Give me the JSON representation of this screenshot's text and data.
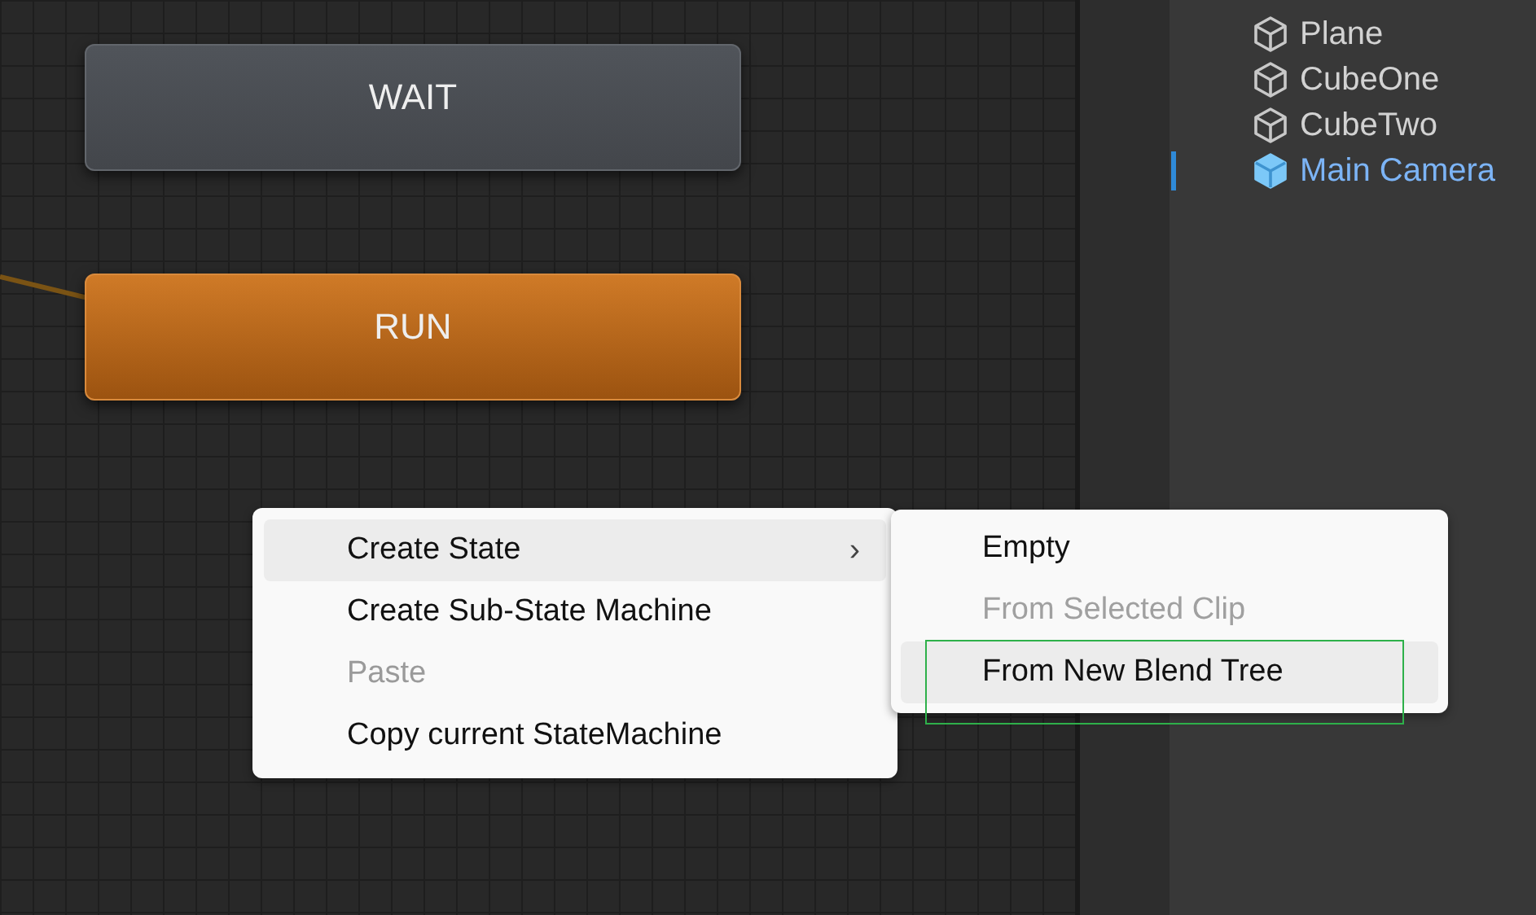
{
  "nodes": [
    {
      "label": "WAIT",
      "kind": "default"
    },
    {
      "label": "RUN",
      "kind": "entry"
    }
  ],
  "hierarchy": [
    {
      "label": "Plane",
      "selected": false
    },
    {
      "label": "CubeOne",
      "selected": false
    },
    {
      "label": "CubeTwo",
      "selected": false
    },
    {
      "label": "Main Camera",
      "selected": true
    }
  ],
  "context_menu": [
    {
      "label": "Create State",
      "disabled": false,
      "selected": true,
      "submenu": true
    },
    {
      "label": "Create Sub-State Machine",
      "disabled": false,
      "selected": false,
      "submenu": false
    },
    {
      "label": "Paste",
      "disabled": true,
      "selected": false,
      "submenu": false
    },
    {
      "label": "Copy current StateMachine",
      "disabled": false,
      "selected": false,
      "submenu": false
    }
  ],
  "submenu_arrow": "›",
  "submenu": [
    {
      "label": "Empty",
      "disabled": false,
      "selected": false,
      "outlined": false
    },
    {
      "label": "From Selected Clip",
      "disabled": true,
      "selected": false,
      "outlined": false
    },
    {
      "label": "From New Blend Tree",
      "disabled": false,
      "selected": true,
      "outlined": true
    }
  ]
}
